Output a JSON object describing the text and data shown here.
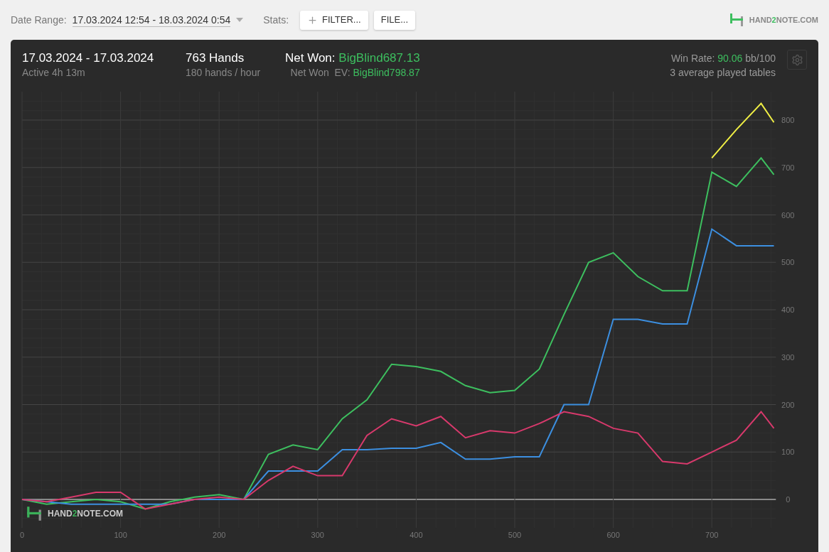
{
  "toolbar": {
    "date_range_label": "Date Range:",
    "date_range_value": "17.03.2024 12:54 - 18.03.2024 0:54",
    "stats_label": "Stats:",
    "buttons": [
      {
        "kind": "add",
        "label": "FILTER..."
      },
      {
        "kind": "plain",
        "label": "FILE..."
      }
    ],
    "logo": [
      "HAND",
      "2",
      "NOTE.COM"
    ]
  },
  "summary": {
    "period": "17.03.2024 - 17.03.2024",
    "active": "Active 4h 13m",
    "hands": "763 Hands",
    "hands_rate": "180 hands / hour",
    "net_won_label": "Net Won:",
    "net_won_value": "BigBlind687.13",
    "net_won_ev_label": "Net Won  EV:",
    "net_won_ev_value": "BigBlind798.87",
    "win_rate_label": "Win Rate:",
    "win_rate_value": "90.06",
    "win_rate_unit": "bb/100",
    "tables": "3 average played tables"
  },
  "chart": {
    "watermark": [
      "HAND",
      "2",
      "NOTE.COM"
    ],
    "chart_data": {
      "type": "line",
      "x": [
        0,
        25,
        50,
        75,
        100,
        125,
        150,
        175,
        200,
        225,
        250,
        275,
        300,
        325,
        350,
        375,
        400,
        425,
        450,
        475,
        500,
        525,
        550,
        575,
        600,
        625,
        650,
        675,
        700,
        725,
        750,
        763
      ],
      "xlim": [
        0,
        765
      ],
      "ylim": [
        -60,
        860
      ],
      "xticks": [
        0,
        100,
        200,
        300,
        400,
        500,
        600,
        700
      ],
      "yticks": [
        0,
        100,
        200,
        300,
        400,
        500,
        600,
        700,
        800
      ],
      "grid": true,
      "series": [
        {
          "color": "#f0ef45",
          "values": [
            null,
            null,
            null,
            null,
            null,
            null,
            null,
            null,
            null,
            null,
            null,
            null,
            null,
            null,
            null,
            null,
            null,
            null,
            null,
            null,
            null,
            null,
            null,
            null,
            null,
            null,
            null,
            null,
            720,
            780,
            835,
            795
          ]
        },
        {
          "color": "#3dbf5f",
          "values": [
            0,
            -10,
            -5,
            0,
            -5,
            -20,
            -5,
            5,
            10,
            0,
            95,
            115,
            105,
            170,
            210,
            285,
            280,
            270,
            240,
            225,
            230,
            275,
            390,
            500,
            520,
            470,
            440,
            440,
            690,
            660,
            720,
            685
          ]
        },
        {
          "color": "#3c8fe0",
          "values": [
            0,
            -5,
            -10,
            -10,
            -10,
            -10,
            -10,
            0,
            0,
            0,
            60,
            60,
            60,
            105,
            105,
            108,
            108,
            120,
            85,
            85,
            90,
            90,
            200,
            200,
            380,
            380,
            370,
            370,
            570,
            535,
            535,
            535
          ]
        },
        {
          "color": "#d8396c",
          "values": [
            0,
            -5,
            5,
            15,
            15,
            -20,
            -10,
            0,
            5,
            0,
            40,
            70,
            50,
            50,
            135,
            170,
            155,
            175,
            130,
            145,
            140,
            160,
            185,
            175,
            150,
            140,
            80,
            75,
            100,
            125,
            185,
            150
          ]
        }
      ]
    }
  }
}
